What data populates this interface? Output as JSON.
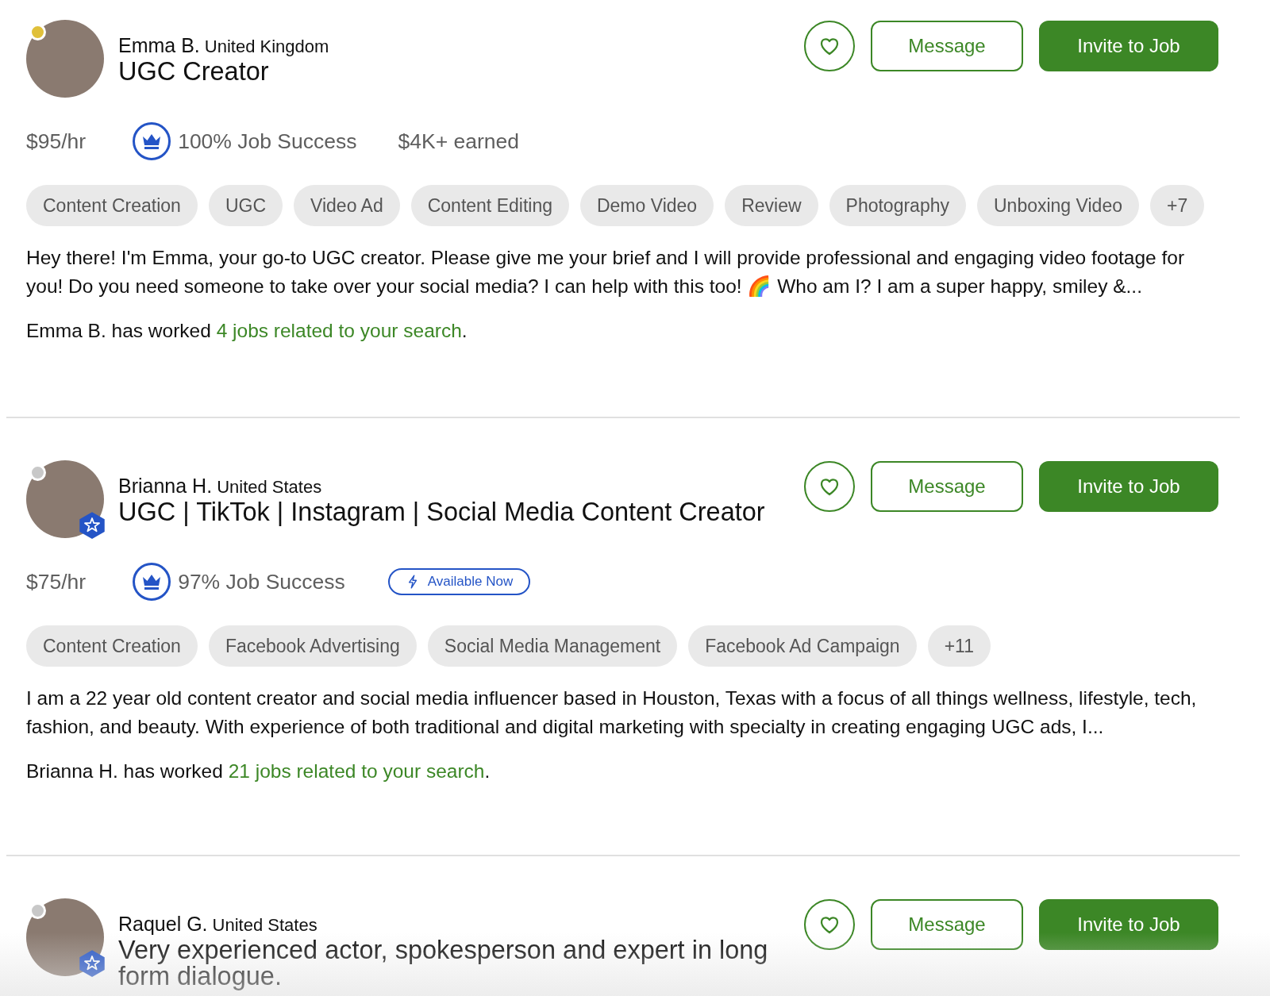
{
  "freelancers": [
    {
      "name": "Emma B.",
      "country": "United Kingdom",
      "title": "UGC Creator",
      "color": "#e0c03a",
      "top_rated": false,
      "rate": "$95/hr",
      "job_success": "100% Job Success",
      "earned": "$4K+ earned",
      "skills": [
        "Content Creation",
        "UGC",
        "Video Ad",
        "Content Editing",
        "Demo Video",
        "Review",
        "Photography",
        "Unboxing Video",
        "+7"
      ],
      "description": "Hey there! I'm Emma, your go-to UGC creator. Please give me your brief and I will provide professional and engaging video footage for you! Do you need someone to take over your social media? I can help with this too! 🌈 Who am I? I am a super happy, smiley &...",
      "worked_prefix": "Emma B. has worked",
      "worked_link": "4 jobs related to your search",
      "worked_suffix": ".",
      "buttons": {
        "message": "Message",
        "invite": "Invite to Job"
      }
    },
    {
      "name": "Brianna H.",
      "country": "United States",
      "title": "UGC | TikTok | Instagram | Social Media Content Creator",
      "color": "#c8c8c8",
      "top_rated": true,
      "rate": "$75/hr",
      "job_success": "97% Job Success",
      "available": "Available Now",
      "skills": [
        "Content Creation",
        "Facebook Advertising",
        "Social Media Management",
        "Facebook Ad Campaign",
        "+11"
      ],
      "description": "I am a 22 year old content creator and social media influencer based in Houston, Texas with a focus of all things wellness, lifestyle, tech, fashion, and beauty. With experience of both traditional and digital marketing with specialty in creating engaging UGC ads, I...",
      "worked_prefix": "Brianna H. has worked",
      "worked_link": "21 jobs related to your search",
      "worked_suffix": ".",
      "buttons": {
        "message": "Message",
        "invite": "Invite to Job"
      }
    },
    {
      "name": "Raquel G.",
      "country": "United States",
      "title": "Very experienced actor, spokesperson and expert in long form dialogue.",
      "color": "#c8c8c8",
      "top_rated": true,
      "buttons": {
        "message": "Message",
        "invite": "Invite to Job"
      }
    }
  ]
}
